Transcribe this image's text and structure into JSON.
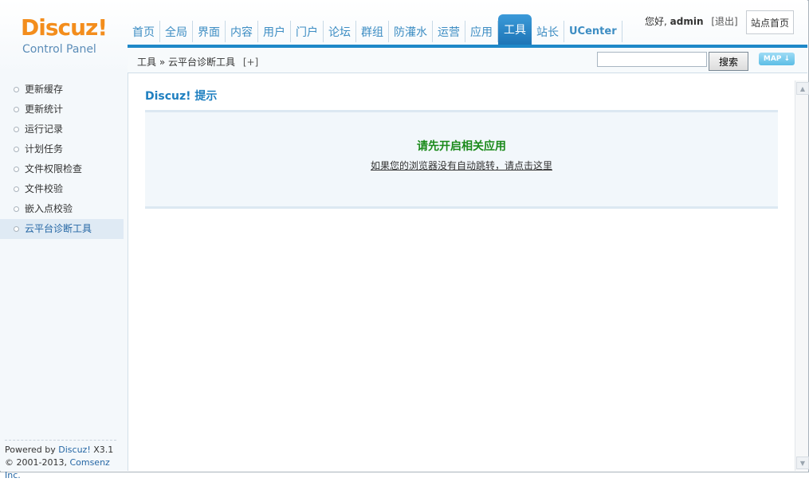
{
  "logo": {
    "main": "Discuz!",
    "sub": "Control Panel"
  },
  "nav": {
    "items": [
      {
        "label": "首页",
        "active": false,
        "latin": false
      },
      {
        "label": "全局",
        "active": false,
        "latin": false
      },
      {
        "label": "界面",
        "active": false,
        "latin": false
      },
      {
        "label": "内容",
        "active": false,
        "latin": false
      },
      {
        "label": "用户",
        "active": false,
        "latin": false
      },
      {
        "label": "门户",
        "active": false,
        "latin": false
      },
      {
        "label": "论坛",
        "active": false,
        "latin": false
      },
      {
        "label": "群组",
        "active": false,
        "latin": false
      },
      {
        "label": "防灌水",
        "active": false,
        "latin": false
      },
      {
        "label": "运营",
        "active": false,
        "latin": false
      },
      {
        "label": "应用",
        "active": false,
        "latin": false
      },
      {
        "label": "工具",
        "active": true,
        "latin": false
      },
      {
        "label": "站长",
        "active": false,
        "latin": false
      },
      {
        "label": "UCenter",
        "active": false,
        "latin": true
      }
    ]
  },
  "user": {
    "greeting": "您好,",
    "name": "admin",
    "logout": "[退出]",
    "home_button": "站点首页"
  },
  "breadcrumb": {
    "path": "工具 » 云平台诊断工具",
    "plus": "[+]"
  },
  "search": {
    "value": "",
    "button": "搜索"
  },
  "map_button": "MAP ↓",
  "sidebar": {
    "items": [
      {
        "label": "更新缓存",
        "active": false
      },
      {
        "label": "更新统计",
        "active": false
      },
      {
        "label": "运行记录",
        "active": false
      },
      {
        "label": "计划任务",
        "active": false
      },
      {
        "label": "文件权限检查",
        "active": false
      },
      {
        "label": "文件校验",
        "active": false
      },
      {
        "label": "嵌入点校验",
        "active": false
      },
      {
        "label": "云平台诊断工具",
        "active": true
      }
    ],
    "footer": {
      "powered_prefix": "Powered by ",
      "powered_link": "Discuz!",
      "version": " X3.1",
      "copyright_prefix": "© 2001-2013, ",
      "copyright_link": "Comsenz Inc."
    }
  },
  "main": {
    "title": "Discuz! 提示",
    "message": "请先开启相关应用",
    "redirect_link": "如果您的浏览器没有自动跳转，请点击这里"
  },
  "colors": {
    "accent": "#1e88c8",
    "nav_text": "#3d8dc3",
    "success": "#1a8a1a",
    "logo": "#f38d1c"
  }
}
